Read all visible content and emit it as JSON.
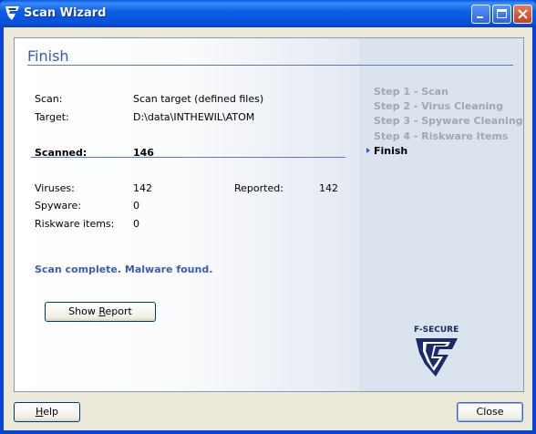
{
  "window": {
    "title": "Scan Wizard"
  },
  "page": {
    "title": "Finish"
  },
  "summary": {
    "scan_label": "Scan:",
    "scan_value": "Scan target (defined files)",
    "target_label": "Target:",
    "target_value": "D:\\data\\INTHEWIL\\ATOM",
    "scanned_label": "Scanned:",
    "scanned_value": "146",
    "viruses_label": "Viruses:",
    "viruses_value": "142",
    "reported_label": "Reported:",
    "reported_value": "142",
    "spyware_label": "Spyware:",
    "spyware_value": "0",
    "riskware_label": "Riskware items:",
    "riskware_value": "0"
  },
  "status": "Scan complete. Malware found.",
  "buttons": {
    "show_report_pre": "Show ",
    "show_report_key": "R",
    "show_report_post": "eport",
    "help_key": "H",
    "help_post": "elp",
    "close_label": "Close"
  },
  "steps": [
    {
      "label": "Step 1 - Scan",
      "active": false
    },
    {
      "label": "Step 2 - Virus Cleaning",
      "active": false
    },
    {
      "label": "Step 3 - Spyware Cleaning",
      "active": false
    },
    {
      "label": "Step 4 - Riskware Items",
      "active": false
    },
    {
      "label": "Finish",
      "active": true
    }
  ],
  "logo": {
    "text": "F-SECURE"
  },
  "colors": {
    "accent": "#3a5ab8",
    "titlebar": "#0842d6",
    "inactive_step": "#a2a8b1"
  }
}
